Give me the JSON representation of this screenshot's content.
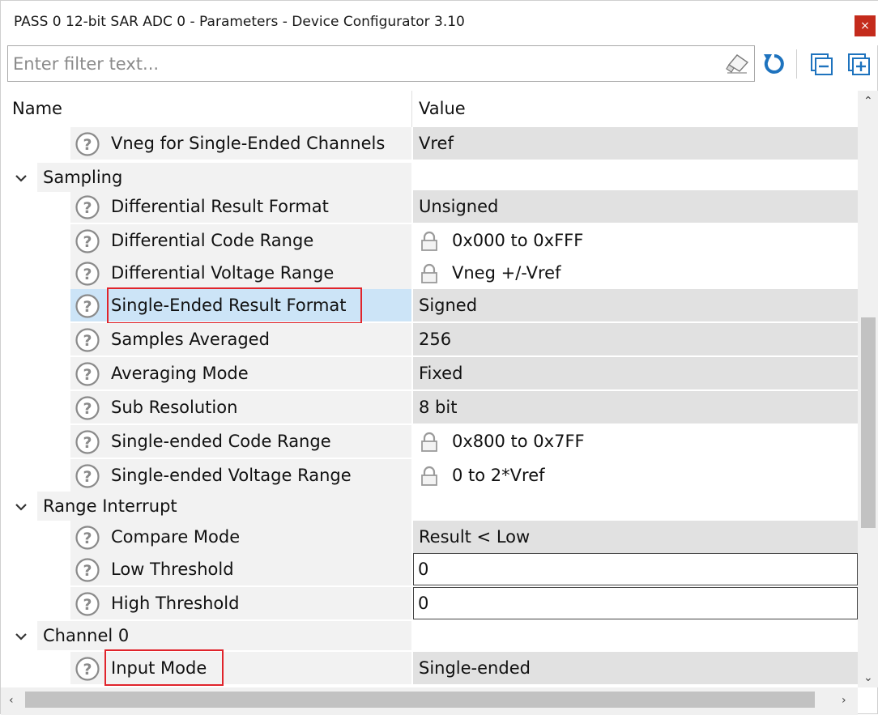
{
  "window": {
    "title": "PASS 0 12-bit SAR ADC 0 - Parameters - Device Configurator 3.10",
    "close_glyph": "×"
  },
  "filter": {
    "placeholder": "Enter filter text..."
  },
  "toolbar": {
    "icons": [
      "eraser-icon",
      "refresh-icon",
      "collapse-all-icon",
      "expand-all-icon"
    ]
  },
  "columns": {
    "name": "Name",
    "value": "Value"
  },
  "rows": [
    {
      "kind": "param",
      "label": "Vneg for Single-Ended Channels",
      "value": "Vref",
      "value_type": "dropdown"
    },
    {
      "kind": "group",
      "label": "Sampling"
    },
    {
      "kind": "param",
      "label": "Differential Result Format",
      "value": "Unsigned",
      "value_type": "dropdown"
    },
    {
      "kind": "param",
      "label": "Differential Code Range",
      "value": "0x000 to 0xFFF",
      "value_type": "locked"
    },
    {
      "kind": "param",
      "label": "Differential Voltage Range",
      "value": "Vneg +/-Vref",
      "value_type": "locked"
    },
    {
      "kind": "param",
      "label": "Single-Ended Result Format",
      "value": "Signed",
      "value_type": "dropdown",
      "selected": true,
      "highlighted": true
    },
    {
      "kind": "param",
      "label": "Samples Averaged",
      "value": "256",
      "value_type": "dropdown"
    },
    {
      "kind": "param",
      "label": "Averaging Mode",
      "value": "Fixed",
      "value_type": "dropdown"
    },
    {
      "kind": "param",
      "label": "Sub Resolution",
      "value": "8 bit",
      "value_type": "dropdown"
    },
    {
      "kind": "param",
      "label": "Single-ended Code Range",
      "value": "0x800 to 0x7FF",
      "value_type": "locked"
    },
    {
      "kind": "param",
      "label": "Single-ended Voltage Range",
      "value": "0 to 2*Vref",
      "value_type": "locked"
    },
    {
      "kind": "group",
      "label": "Range Interrupt"
    },
    {
      "kind": "param",
      "label": "Compare Mode",
      "value": "Result < Low",
      "value_type": "dropdown"
    },
    {
      "kind": "param",
      "label": "Low Threshold",
      "value": "0",
      "value_type": "editable"
    },
    {
      "kind": "param",
      "label": "High Threshold",
      "value": "0",
      "value_type": "editable"
    },
    {
      "kind": "group",
      "label": "Channel 0"
    },
    {
      "kind": "param",
      "label": "Input Mode",
      "value": "Single-ended",
      "value_type": "dropdown",
      "highlighted": true
    }
  ],
  "colors": {
    "selection": "#cce4f7",
    "callout": "#e0242b",
    "dropdown_bg": "#e1e1e1",
    "refresh_blue": "#1e73be"
  }
}
